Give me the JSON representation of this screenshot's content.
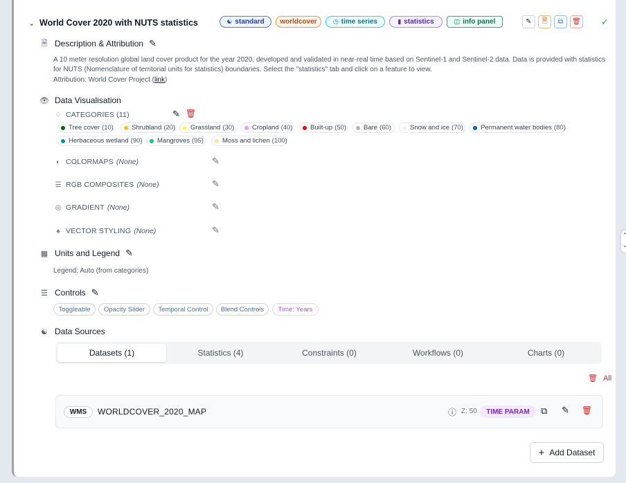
{
  "header": {
    "title": "World Cover 2020 with NUTS statistics",
    "tags": [
      {
        "label": "standard",
        "icon": "database-icon",
        "color": "#1e40af",
        "border": "#3b82f6",
        "bg": "#eff6ff"
      },
      {
        "label": "worldcover",
        "icon": "",
        "color": "#c2410c",
        "border": "#fb923c",
        "bg": "#fff7ed"
      },
      {
        "label": "time series",
        "icon": "clock-icon",
        "color": "#0e7490",
        "border": "#22d3ee",
        "bg": "#ecfeff"
      },
      {
        "label": "statistics",
        "icon": "bar-chart-icon",
        "color": "#5b21b6",
        "border": "#a78bfa",
        "bg": "#f5f3ff"
      },
      {
        "label": "info panel",
        "icon": "panel-icon",
        "color": "#047857",
        "border": "#10b981",
        "bg": "#ecfdf5"
      }
    ],
    "status_icon": "check-icon"
  },
  "description": {
    "label": "Description & Attribution",
    "text": "A 10 meter resolution global land cover product for the year 2020, developed and validated in near-real time based on Sentinel-1 and Sentinel-2 data. Data is provided with statistics for NUTS (Nomenclature of territorial units for statistics) boundaries. Select the \"statistics\" tab and click on a feature to view.",
    "attribution_prefix": "Attribution: World Cover Project (",
    "attribution_link": "link",
    "attribution_suffix": ")"
  },
  "visualisation": {
    "label": "Data Visualisation",
    "categories_label": "CATEGORIES (11)",
    "categories": [
      {
        "name": "Tree cover",
        "value": "(10)",
        "color": "#006400"
      },
      {
        "name": "Shrubland",
        "value": "(20)",
        "color": "#ffbb22"
      },
      {
        "name": "Grassland",
        "value": "(30)",
        "color": "#ffff4c"
      },
      {
        "name": "Cropland",
        "value": "(40)",
        "color": "#f096ff"
      },
      {
        "name": "Built-up",
        "value": "(50)",
        "color": "#fa0000"
      },
      {
        "name": "Bare",
        "value": "(60)",
        "color": "#b4b4b4"
      },
      {
        "name": "Snow and ice",
        "value": "(70)",
        "color": "#f0f0f0"
      },
      {
        "name": "Permanent water bodies",
        "value": "(80)",
        "color": "#0064c8"
      },
      {
        "name": "Herbaceous wetland",
        "value": "(90)",
        "color": "#0096a0"
      },
      {
        "name": "Mangroves",
        "value": "(95)",
        "color": "#00cf75"
      },
      {
        "name": "Moss and lichen",
        "value": "(100)",
        "color": "#fae6a0"
      }
    ],
    "colormaps_label": "COLORMAPS",
    "colormaps_value": "(None)",
    "rgb_label": "RGB COMPOSITES",
    "rgb_value": "(None)",
    "gradient_label": "GRADIENT",
    "gradient_value": "(None)",
    "vector_label": "VECTOR STYLING",
    "vector_value": "(None)"
  },
  "units": {
    "label": "Units and Legend",
    "legend_text": "Legend: Auto (from categories)"
  },
  "controls": {
    "label": "Controls",
    "items": [
      "Toggleable",
      "Opacity Slider",
      "Temporal Control",
      "Blend Controls",
      "Time: Years"
    ]
  },
  "data_sources": {
    "label": "Data Sources",
    "tabs": [
      "Datasets (1)",
      "Statistics (4)",
      "Constraints (0)",
      "Workflows (0)",
      "Charts (0)"
    ],
    "active_tab": "Datasets (1)",
    "delete_all_label": "All",
    "dataset": {
      "type": "WMS",
      "name": "WORLDCOVER_2020_MAP",
      "z_label": "Z: 50",
      "param_badge": "TIME PARAM"
    },
    "add_label": "Add Dataset"
  }
}
